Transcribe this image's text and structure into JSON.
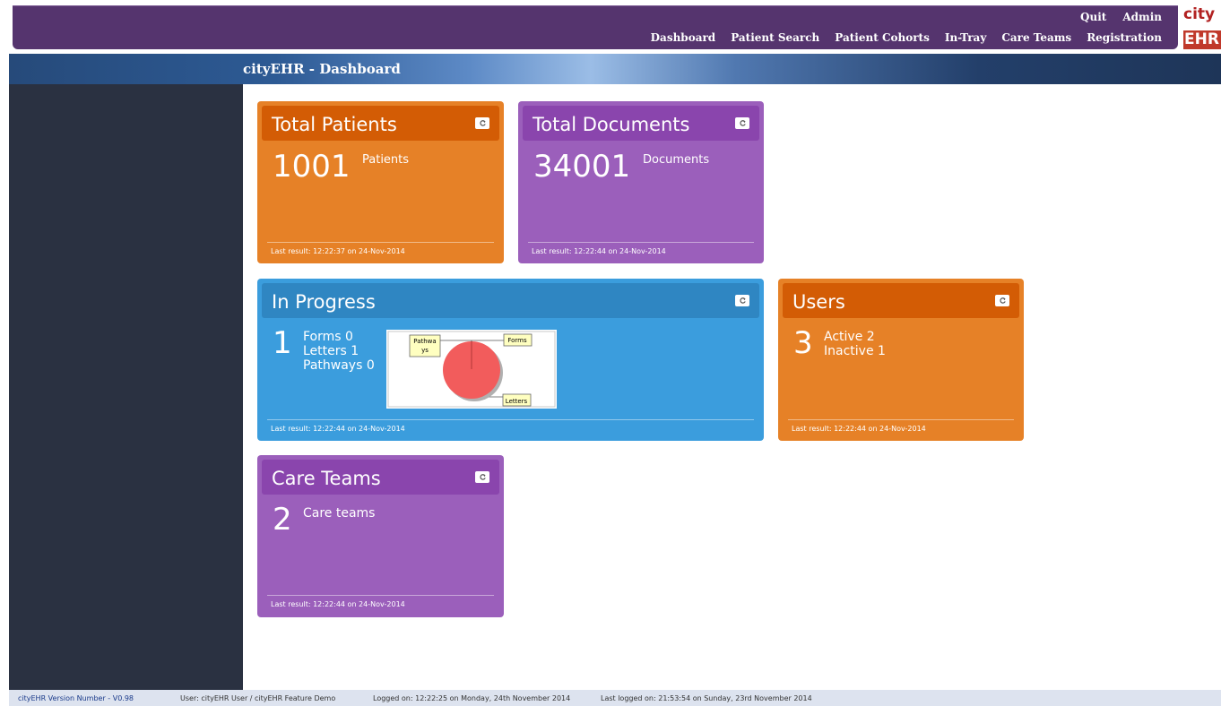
{
  "nav": {
    "upper": [
      "Quit",
      "Admin"
    ],
    "lower": [
      "Dashboard",
      "Patient Search",
      "Patient Cohorts",
      "In-Tray",
      "Care Teams",
      "Registration"
    ]
  },
  "logo": {
    "top": "city",
    "bottom": "EHR"
  },
  "page_title": "cityEHR - Dashboard",
  "panels": {
    "total_patients": {
      "title": "Total Patients",
      "value": "1001",
      "unit": "Patients",
      "last_result": "Last result: 12:22:37 on 24-Nov-2014"
    },
    "total_documents": {
      "title": "Total Documents",
      "value": "34001",
      "unit": "Documents",
      "last_result": "Last result: 12:22:44 on 24-Nov-2014"
    },
    "in_progress": {
      "title": "In Progress",
      "value": "1",
      "lines": [
        "Forms 0",
        "Letters 1",
        "Pathways 0"
      ],
      "chart_labels": {
        "pathways": "Pathwa ys",
        "forms": "Forms",
        "letters": "Letters"
      },
      "last_result": "Last result: 12:22:44 on 24-Nov-2014"
    },
    "users": {
      "title": "Users",
      "value": "3",
      "lines": [
        "Active 2",
        "Inactive 1"
      ],
      "last_result": "Last result: 12:22:44 on 24-Nov-2014"
    },
    "care_teams": {
      "title": "Care Teams",
      "value": "2",
      "unit": "Care teams",
      "last_result": "Last result: 12:22:44 on 24-Nov-2014"
    }
  },
  "colors": {
    "orange": "#e68127",
    "purple": "#9b5fbb",
    "blue": "#3b9ddd",
    "pie": "#f25c5c"
  },
  "status": {
    "version": "cityEHR Version Number - V0.98",
    "user": "User: cityEHR User / cityEHR Feature Demo",
    "logged_on": "Logged on: 12:22:25 on Monday, 24th November 2014",
    "last_logged_on": "Last logged on: 21:53:54 on Sunday, 23rd November 2014"
  }
}
